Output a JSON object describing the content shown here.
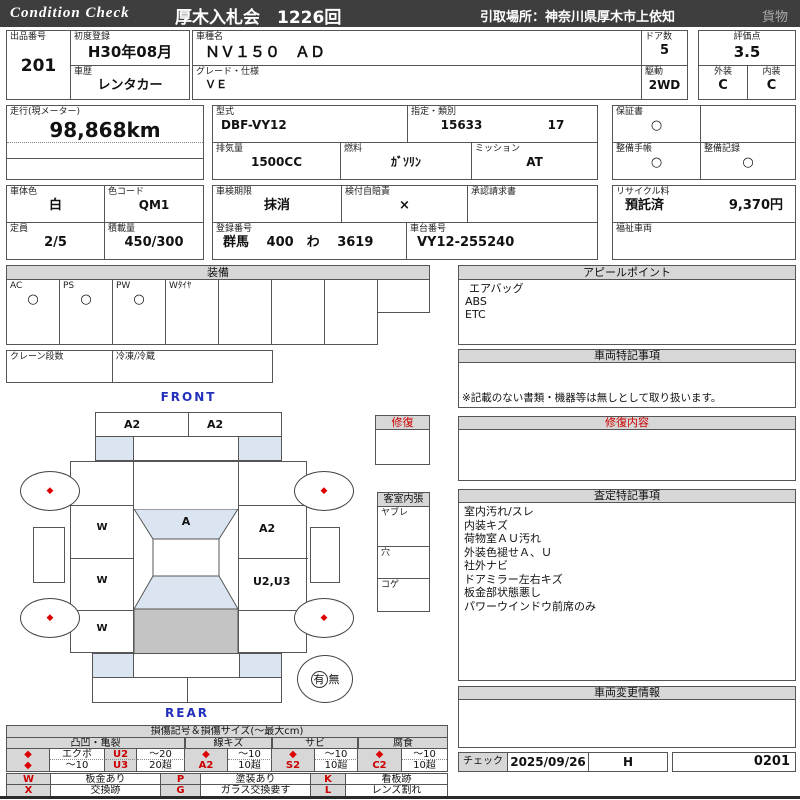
{
  "titlebar": {
    "logo": "Condition  Check",
    "auction": "厚木入札会　1226回",
    "pickup": "引取場所：神奈川県厚木市上依知",
    "cargo": "貨物"
  },
  "colors": {
    "accent_red": "#cc0000",
    "label_blue": "#2330bb",
    "shade_blue": "#dbe5f1",
    "header_gray": "#d7d7d7",
    "cargo_gray": "#c4c4c4",
    "titlebar_gray": "#3e3e3e"
  },
  "info": {
    "lot_label": "出品番号",
    "lot": "201",
    "first_reg_label": "初度登録",
    "first_reg": "H30年08月",
    "model_name_label": "車種名",
    "model_name": "ＮＶ１５０　ＡＤ",
    "history_label": "車歴",
    "history": "レンタカー",
    "grade_label": "グレード・仕様",
    "grade": "ＶＥ",
    "doors_label": "ドア数",
    "doors": "5",
    "drive_label": "駆動",
    "drive": "2WD",
    "score_label": "評価点",
    "score": "3.5",
    "exterior_label": "外装",
    "exterior": "C",
    "interior_label": "内装",
    "interior": "C",
    "mileage_label": "走行(現メーター)",
    "mileage": "98,868km",
    "model_code_label": "型式",
    "model_code": "DBF-VY12",
    "class_label": "指定・類別",
    "class1": "15633",
    "class2": "17",
    "warranty_label": "保証書",
    "warranty": "○",
    "displacement_label": "排気量",
    "displacement": "1500CC",
    "fuel_label": "燃料",
    "fuel": "ｶﾞｿﾘﾝ",
    "mission_label": "ミッション",
    "mission": "AT",
    "maintenance_book_label": "整備手帳",
    "maintenance_book": "○",
    "maintenance_record_label": "整備記録",
    "maintenance_record": "○",
    "color_label": "車体色",
    "color": "白",
    "color_code_label": "色コード",
    "color_code": "QM1",
    "inspection_label": "車検期限",
    "inspection": "抹消",
    "insurance_label": "検付自賠責",
    "insurance": "×",
    "approval_label": "承認請求書",
    "recycle_label": "リサイクル料",
    "recycle_status": "預託済",
    "recycle_fee": "9,370円",
    "capacity_label": "定員",
    "capacity": "2/5",
    "load_label": "積載量",
    "load": "450/300",
    "reg_no_label": "登録番号",
    "reg_no": "群馬　 400　わ　 3619",
    "chassis_label": "車台番号",
    "chassis": "VY12-255240",
    "welfare_label": "福祉車両"
  },
  "equipment": {
    "title": "装備",
    "items": [
      {
        "label": "AC",
        "value": "○"
      },
      {
        "label": "PS",
        "value": "○"
      },
      {
        "label": "PW",
        "value": "○"
      },
      {
        "label": "Wﾀｲﾔ",
        "value": ""
      },
      {
        "label": "",
        "value": ""
      },
      {
        "label": "",
        "value": ""
      },
      {
        "label": "",
        "value": ""
      },
      {
        "label": "",
        "value": ""
      }
    ],
    "crane_label": "クレーン段数",
    "fridge_label": "冷凍/冷蔵"
  },
  "appeal": {
    "title": "アピールポイント",
    "lines": [
      "エアバッグ",
      "ABS",
      "ETC"
    ]
  },
  "vehicle_notes": {
    "title": "車両特記事項",
    "note": "※記載のない書類・機器等は無しとして取り扱います。"
  },
  "repair": {
    "title": "修復"
  },
  "repair_detail": {
    "title": "修復内容"
  },
  "cabin": {
    "title": "客室内張",
    "rows": [
      "ヤブレ",
      "穴",
      "コゲ"
    ]
  },
  "assessment": {
    "title": "査定特記事項",
    "lines": [
      "室内汚れ/スレ",
      "内装キズ",
      "荷物室ＡＵ汚れ",
      "外装色褪せＡ、Ｕ",
      "社外ナビ",
      "ドアミラー左右キズ",
      "板金部状態悪し",
      "パワーウインドウ前席のみ"
    ]
  },
  "change_info": {
    "title": "車両変更情報"
  },
  "check": {
    "label": "チェック",
    "date": "2025/09/26",
    "inspector": "H",
    "code": "0201"
  },
  "diagram": {
    "front_label": "FRONT",
    "rear_label": "REAR",
    "front_bumper_left": "A2",
    "front_bumper_right": "A2",
    "windshield": "A",
    "left_marks": [
      "W",
      "W",
      "W"
    ],
    "right_top": "A2",
    "right_mid": "U2,U3",
    "wheel_mark": "◆",
    "avail_yes": "有",
    "avail_no": "無"
  },
  "legend": {
    "title": "損傷記号＆損傷サイズ(〜最大cm)",
    "groups": [
      {
        "name": "凸凹・亀裂",
        "rows": [
          [
            "◆",
            "エクボ",
            "U2",
            "〜20"
          ],
          [
            "◆",
            "〜10",
            "U3",
            "20超"
          ]
        ]
      },
      {
        "name": "線キズ",
        "rows": [
          [
            "◆",
            "〜10"
          ],
          [
            "A2",
            "10超"
          ]
        ]
      },
      {
        "name": "サビ",
        "rows": [
          [
            "◆",
            "〜10"
          ],
          [
            "S2",
            "10超"
          ]
        ]
      },
      {
        "name": "腐食",
        "rows": [
          [
            "◆",
            "〜10"
          ],
          [
            "C2",
            "10超"
          ]
        ]
      }
    ],
    "codes": [
      {
        "letter": "W",
        "desc": "板金あり"
      },
      {
        "letter": "X",
        "desc": "交換跡"
      },
      {
        "letter": "P",
        "desc": "塗装あり"
      },
      {
        "letter": "G",
        "desc": "ガラス交換要す"
      },
      {
        "letter": "K",
        "desc": "看板跡"
      },
      {
        "letter": "L",
        "desc": "レンズ割れ"
      }
    ]
  }
}
